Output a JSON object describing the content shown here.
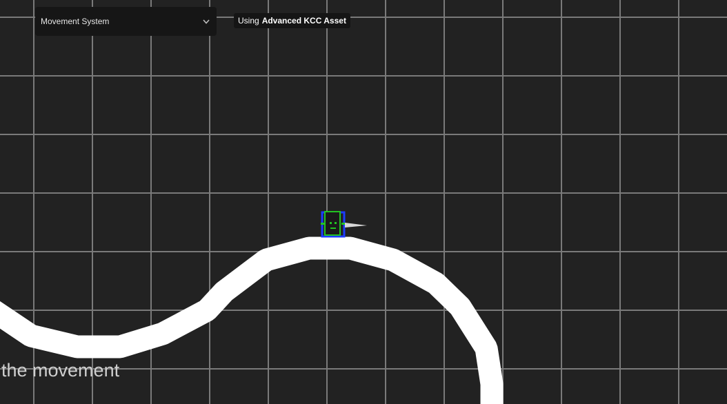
{
  "menu": {
    "selected": "Movement System",
    "chevron_icon": "chevron-down-icon"
  },
  "badge": {
    "prefix": "Using",
    "strong": "Advanced KCC Asset"
  },
  "caption": {
    "text": "the movement"
  },
  "colors": {
    "background": "#222222",
    "grid": "#8a8a8a",
    "track": "#ffffff",
    "player_outline": "#22c322",
    "player_body": "#1a1a1a",
    "collider": "#1b3cff"
  }
}
